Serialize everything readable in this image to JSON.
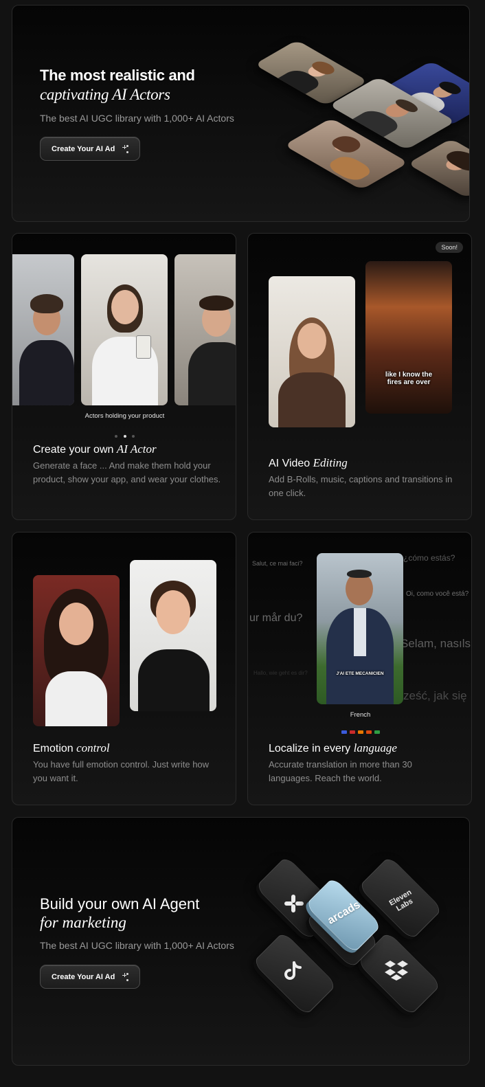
{
  "hero": {
    "title": "The most realistic and",
    "title_italic": "captivating AI Actors",
    "subtitle": "The best AI UGC library with 1,000+ AI Actors",
    "cta_label": "Create Your AI Ad"
  },
  "features": {
    "actor": {
      "caption": "Actors holding your product",
      "title": "Create your own ",
      "title_italic": "AI Actor",
      "description": "Generate a face ... And make them hold your product, show your app, and wear your clothes.",
      "carousel_dots": 3,
      "active_dot": 2
    },
    "editing": {
      "badge": "Soon!",
      "video_caption": "like I know the fires are over",
      "title": "AI Video ",
      "title_italic": "Editing",
      "description": "Add B-Rolls, music, captions and transitions in one click."
    },
    "emotion": {
      "title": "Emotion ",
      "title_italic": "control",
      "description": "You have full emotion control. Just write how you want it."
    },
    "localize": {
      "words": {
        "salut": "Salut, ce mai faci?",
        "como_estas": "¿cómo estás?",
        "oi": "Oi, como você está?",
        "hur_mar": "ur mår du?",
        "selam": "Selam, nasıls",
        "faded": "Hallo, wie geht es dir?",
        "czesc": "ześć, jak się"
      },
      "video_caption": "J'AI ETE MECANICIEN",
      "language_label": "French",
      "flag_colors": [
        "#3b5bdb",
        "#c92a2a",
        "#e67700",
        "#d9480f",
        "#2f9e44"
      ],
      "title": "Localize in every ",
      "title_italic": "language",
      "description": "Accurate translation in more than 30 languages. Reach the world."
    }
  },
  "agent": {
    "title": "Build your own AI Agent",
    "title_italic": "for marketing",
    "subtitle": "The best AI UGC library with 1,000+ AI Actors",
    "cta_label": "Create Your AI Ad",
    "tiles": {
      "center": "arcads",
      "right": "Eleven Labs"
    }
  }
}
